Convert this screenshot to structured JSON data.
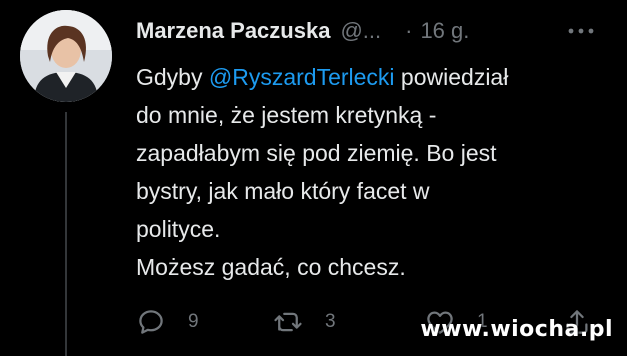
{
  "tweet": {
    "author_name": "Marzena Paczuska",
    "author_handle": "@...",
    "separator": "·",
    "time": "16 g.",
    "more_icon": "more-dots-icon",
    "body_lines": [
      {
        "before": "Gdyby ",
        "mention": "@RyszardTerlecki",
        "after": " powiedział"
      },
      {
        "text": "do mnie, że jestem kretynką -"
      },
      {
        "text": "zapadłabym się pod ziemię. Bo jest"
      },
      {
        "text": "bystry, jak mało który facet w"
      },
      {
        "text": "polityce."
      },
      {
        "text": "Możesz gadać, co chcesz."
      }
    ],
    "actions": {
      "reply_count": "9",
      "retweet_count": "3",
      "like_count": "1"
    }
  },
  "watermark": "www.wiocha.pl",
  "colors": {
    "background": "#000000",
    "text": "#e7e9ea",
    "muted": "#71767b",
    "link": "#1d9bf0"
  }
}
